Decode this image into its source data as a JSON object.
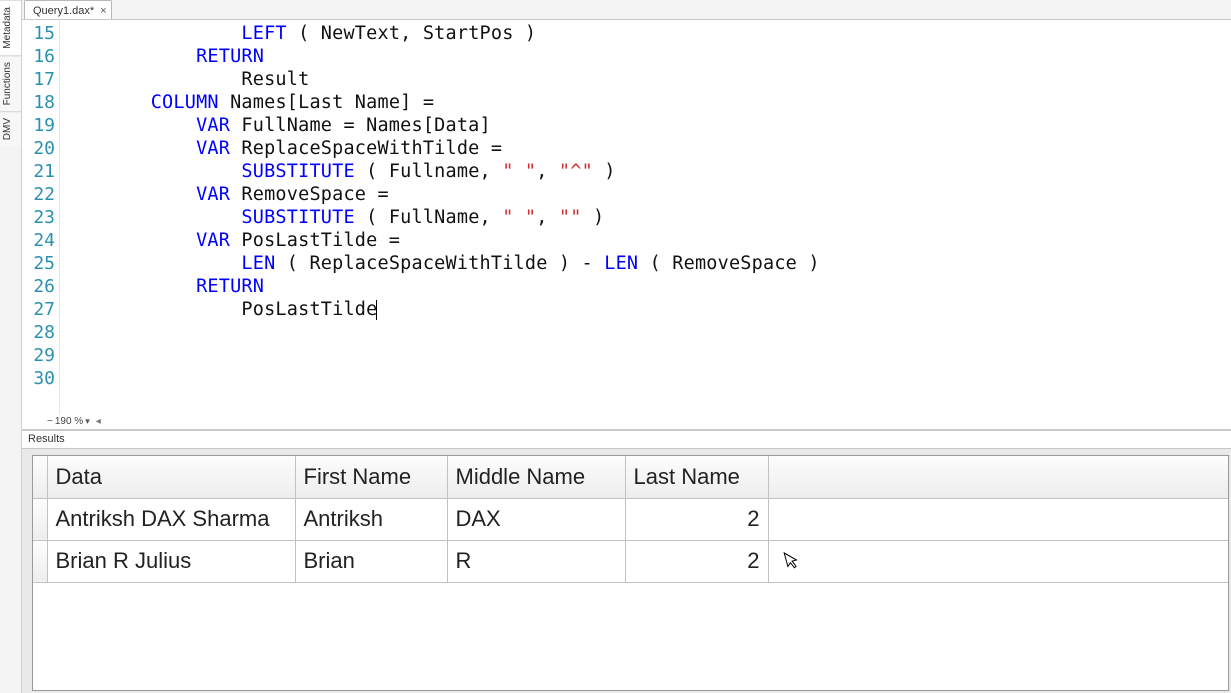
{
  "sideTabs": [
    "Metadata",
    "Functions",
    "DMV"
  ],
  "docTab": {
    "title": "Query1.dax*",
    "close": "×"
  },
  "editor": {
    "startLine": 15,
    "lineCount": 16,
    "zoom": "190 %",
    "lines": {
      "l15": {
        "t0": "LEFT",
        "t1": " ( NewText, StartPos )"
      },
      "l16": {
        "t0": "RETURN"
      },
      "l17": {
        "t0": "Result"
      },
      "l18": {
        "t0": "COLUMN",
        "t1": " Names[Last Name] ="
      },
      "l19": {
        "t0": "VAR",
        "t1": " FullName = Names[Data]"
      },
      "l20": {
        "t0": "VAR",
        "t1": " ReplaceSpaceWithTilde ="
      },
      "l21": {
        "t0": "SUBSTITUTE",
        "t1": " ( Fullname, ",
        "s0": "\" \"",
        "t2": ", ",
        "s1": "\"^\"",
        "t3": " )"
      },
      "l22": {
        "t0": "VAR",
        "t1": " RemoveSpace ="
      },
      "l23": {
        "t0": "SUBSTITUTE",
        "t1": " ( FullName, ",
        "s0": "\" \"",
        "t2": ", ",
        "s1": "\"\"",
        "t3": " )"
      },
      "l24": {
        "t0": "VAR",
        "t1": " PosLastTilde ="
      },
      "l25": {
        "t0": "LEN",
        "t1": " ( ReplaceSpaceWithTilde ) - ",
        "t2": "LEN",
        "t3": " ( RemoveSpace )"
      },
      "l26": {
        "t0": "RETURN"
      },
      "l27": {
        "t0": "PosLastTilde"
      }
    }
  },
  "results": {
    "tabLabel": "Results",
    "headers": [
      "Data",
      "First Name",
      "Middle Name",
      "Last Name"
    ],
    "rows": [
      {
        "c0": "Antriksh DAX Sharma",
        "c1": "Antriksh",
        "c2": "DAX",
        "c3": "2"
      },
      {
        "c0": "Brian R Julius",
        "c1": "Brian",
        "c2": "R",
        "c3": "2"
      }
    ]
  }
}
